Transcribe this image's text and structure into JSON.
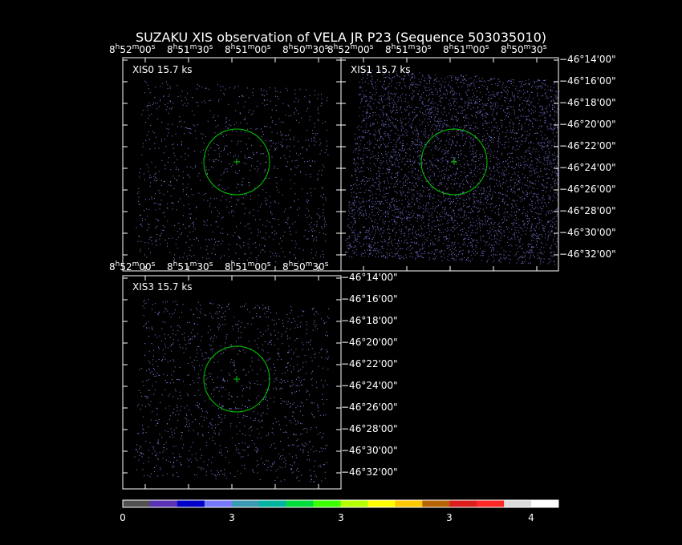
{
  "title": "SUZAKU XIS observation of VELA JR P23  (Sequence 503035010)",
  "ra_labels": [
    {
      "h": "8",
      "m": "52",
      "s": "00"
    },
    {
      "h": "8",
      "m": "51",
      "s": "30"
    },
    {
      "h": "8",
      "m": "51",
      "s": "00"
    },
    {
      "h": "8",
      "m": "50",
      "s": "30"
    }
  ],
  "dec_labels": [
    "−46°14'00\"",
    "−46°16'00\"",
    "−46°18'00\"",
    "−46°20'00\"",
    "−46°22'00\"",
    "−46°24'00\"",
    "−46°26'00\"",
    "−46°28'00\"",
    "−46°30'00\"",
    "−46°32'00\""
  ],
  "panels": [
    {
      "id": "xis0",
      "label": "XIS0  15.7 ks",
      "density": 1100,
      "color": "#8a86e8"
    },
    {
      "id": "xis1",
      "label": "XIS1  15.7 ks",
      "density": 4500,
      "color": "#7a75d6"
    },
    {
      "id": "xis3",
      "label": "XIS3  15.7 ks",
      "density": 1300,
      "color": "#8a86e8"
    }
  ],
  "colors": {
    "background": "#000000",
    "frame": "#ffffff",
    "region": "#00cc00"
  },
  "colorbar": {
    "colors": [
      "#505050",
      "#5a32b4",
      "#0000c8",
      "#7878ff",
      "#3c9bb4",
      "#00b4a0",
      "#00dc3c",
      "#3cff00",
      "#b4ff00",
      "#ffff00",
      "#ffc800",
      "#b46400",
      "#dc1e1e",
      "#ff2828",
      "#dcdcdc",
      "#ffffff"
    ],
    "labels": [
      "0",
      "3",
      "3",
      "3",
      "4"
    ]
  }
}
